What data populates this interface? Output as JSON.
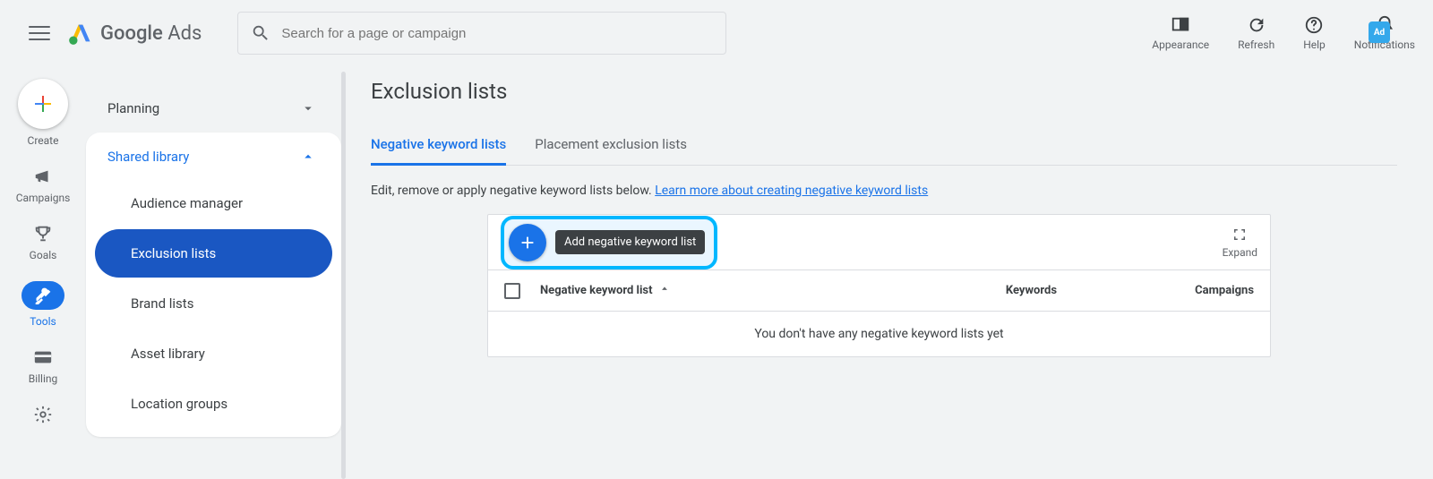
{
  "logo_text_a": "Google",
  "logo_text_b": "Ads",
  "search": {
    "placeholder": "Search for a page or campaign"
  },
  "top_actions": {
    "appearance": "Appearance",
    "refresh": "Refresh",
    "help": "Help",
    "notifications": "Notifications"
  },
  "ad_badge": "Ad",
  "rail": {
    "create": "Create",
    "campaigns": "Campaigns",
    "goals": "Goals",
    "tools": "Tools",
    "billing": "Billing"
  },
  "sidenav": {
    "planning": "Planning",
    "shared_library": "Shared library",
    "items": {
      "audience": "Audience manager",
      "exclusion": "Exclusion lists",
      "brand": "Brand lists",
      "asset": "Asset library",
      "location": "Location groups"
    }
  },
  "main": {
    "title": "Exclusion lists",
    "tabs": {
      "negkw": "Negative keyword lists",
      "placement": "Placement exclusion lists"
    },
    "helptext": "Edit, remove or apply negative keyword lists below. ",
    "helplink": "Learn more about creating negative keyword lists",
    "tooltip": "Add negative keyword list",
    "expand": "Expand",
    "columns": {
      "c1": "Negative keyword list",
      "c2": "Keywords",
      "c3": "Campaigns"
    },
    "empty": "You don't have any negative keyword lists yet"
  }
}
